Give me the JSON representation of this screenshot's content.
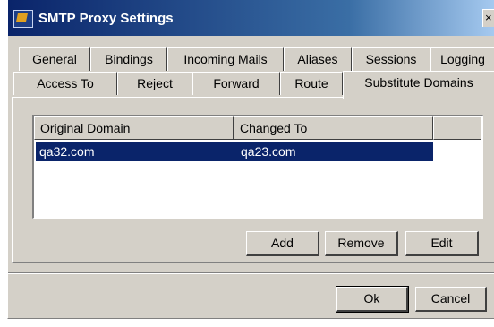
{
  "window": {
    "title": "SMTP Proxy Settings",
    "close_glyph": "×"
  },
  "tabs_row1": [
    "General",
    "Bindings",
    "Incoming Mails",
    "Aliases",
    "Sessions",
    "Logging"
  ],
  "tabs_row2": [
    "Access To",
    "Reject",
    "Forward",
    "Route",
    "Substitute Domains"
  ],
  "active_tab": "Substitute Domains",
  "list": {
    "columns": [
      "Original Domain",
      "Changed To"
    ],
    "rows": [
      {
        "original": "qa32.com",
        "changed": "qa23.com",
        "selected": true
      }
    ]
  },
  "buttons": {
    "add": "Add",
    "remove": "Remove",
    "edit": "Edit",
    "ok": "Ok",
    "cancel": "Cancel"
  },
  "colors": {
    "titlebar": "#0a246a",
    "selection": "#0a246a",
    "face": "#d4d0c8"
  },
  "icons": {
    "app": "smtp-proxy-app-icon",
    "close": "close-icon"
  }
}
